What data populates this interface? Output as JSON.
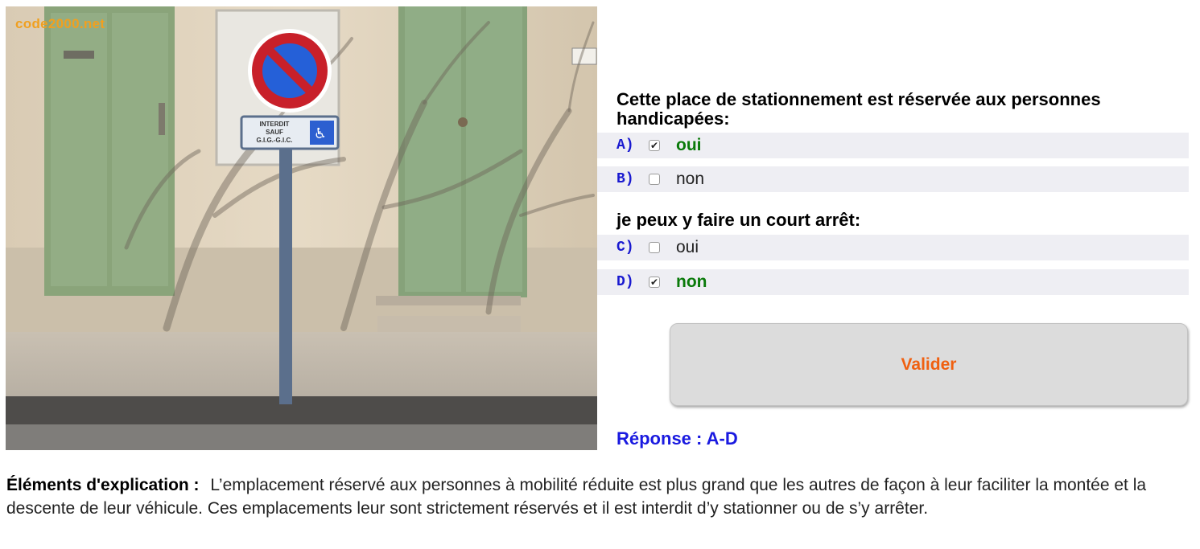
{
  "photo": {
    "watermark": "code2000.net",
    "sign_text_line1": "INTERDIT",
    "sign_text_line2": "SAUF",
    "sign_text_line3": "G.I.G.-G.I.C."
  },
  "question1": {
    "title": "Cette place de stationnement est réservée aux personnes handicapées:",
    "options": [
      {
        "letter": "A)",
        "label": "oui",
        "checked": true,
        "correct": true
      },
      {
        "letter": "B)",
        "label": "non",
        "checked": false,
        "correct": false
      }
    ]
  },
  "question2": {
    "title": "je peux y faire un court arrêt:",
    "options": [
      {
        "letter": "C)",
        "label": "oui",
        "checked": false,
        "correct": false
      },
      {
        "letter": "D)",
        "label": "non",
        "checked": true,
        "correct": true
      }
    ]
  },
  "submit": {
    "label": "Valider"
  },
  "answer": {
    "text": "Réponse : A-D"
  },
  "explanation": {
    "label": "Éléments d'explication :",
    "text": "L’emplacement réservé aux personnes à mobilité réduite est plus grand que les autres de façon à leur faciliter la montée et la descente de leur véhicule. Ces emplacements leur sont strictement réservés et il est interdit d’y stationner ou de s’y arrêter."
  },
  "colors": {
    "correct": "#0a7a0a",
    "letter": "#1a1ad0",
    "submit_text": "#f06010",
    "answer": "#1a1ae0",
    "watermark": "#f0a020"
  }
}
